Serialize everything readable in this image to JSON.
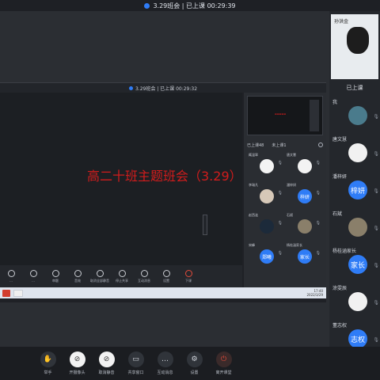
{
  "meeting": {
    "title": "3.29班会 | 已上课 00:29:39",
    "inner_title": "3.29班会 | 已上课 00:29:32"
  },
  "slide": {
    "title": "高二十班主题班会（3.29）"
  },
  "inner_panel": {
    "header_left": "已上课48",
    "header_right": "未上课1",
    "participants": [
      {
        "name": "臧温翠",
        "avatar_text": ""
      },
      {
        "name": "唐文慧",
        "avatar_text": ""
      },
      {
        "name": "李瑞凡",
        "avatar_text": ""
      },
      {
        "name": "潘梓妍",
        "avatar_text": "梓妍"
      },
      {
        "name": "赵西涟",
        "avatar_text": ""
      },
      {
        "name": "石斌",
        "avatar_text": ""
      },
      {
        "name": "宋峰",
        "avatar_text": "郑曦"
      },
      {
        "name": "杨桂涵家长",
        "avatar_text": "家长"
      }
    ]
  },
  "sidebar": {
    "self_name": "孙洪金",
    "section_label": "已上课",
    "participants": [
      {
        "name": "我",
        "avatar_text": ""
      },
      {
        "name": "唐文慧",
        "avatar_text": ""
      },
      {
        "name": "潘梓妍",
        "avatar_text": "梓妍"
      },
      {
        "name": "石斌",
        "avatar_text": ""
      },
      {
        "name": "杨桂涵家长",
        "avatar_text": "家长"
      },
      {
        "name": "涂雯辰",
        "avatar_text": ""
      },
      {
        "name": "董志权",
        "avatar_text": "志权"
      }
    ]
  },
  "bottom_toolbar": [
    {
      "label": "举手",
      "icon": "hand-icon"
    },
    {
      "label": "开摄像头",
      "icon": "camera-icon"
    },
    {
      "label": "取消静音",
      "icon": "mic-icon"
    },
    {
      "label": "共享窗口",
      "icon": "screen-share-icon"
    },
    {
      "label": "互动消息",
      "icon": "chat-icon"
    },
    {
      "label": "设置",
      "icon": "gear-icon"
    },
    {
      "label": "离开课堂",
      "icon": "power-icon"
    }
  ],
  "inner_toolbar": [
    {
      "label": "...",
      "icon": "hand-icon"
    },
    {
      "label": "...",
      "icon": "pin-icon"
    },
    {
      "label": "审题",
      "icon": "doc-icon"
    },
    {
      "label": "音效",
      "icon": "sound-icon"
    },
    {
      "label": "取消全部静音",
      "icon": "mic-icon"
    },
    {
      "label": "停止共享",
      "icon": "screen-share-icon"
    },
    {
      "label": "互动消息",
      "icon": "chat-icon"
    },
    {
      "label": "设置",
      "icon": "gear-icon"
    },
    {
      "label": "下课",
      "icon": "power-icon"
    }
  ],
  "inner_taskbar": {
    "clock_line1": "17:40",
    "clock_line2": "2022/3/29"
  },
  "colors": {
    "accent": "#2f7cf6",
    "slide_title": "#d21c1c",
    "end_button": "#e24b3b"
  }
}
